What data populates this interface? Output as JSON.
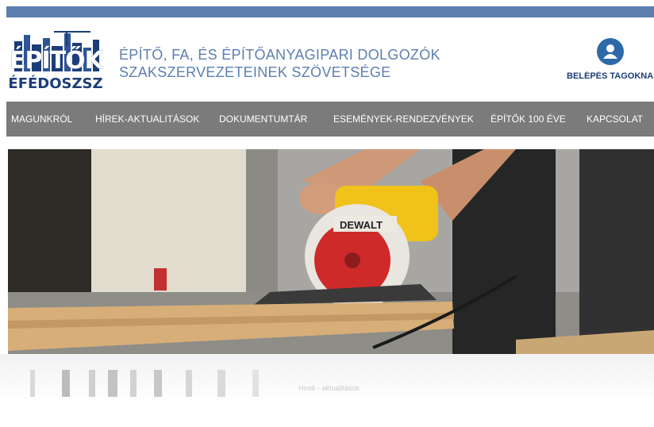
{
  "colors": {
    "accent_bar": "#5c7fb0",
    "brand_dark": "#1c3d78",
    "nav_bg": "#7b7b7b",
    "login_icon": "#2f6aa8"
  },
  "logo": {
    "top_text": "ÉPÍTŐK",
    "bottom_text": "ÉFÉDOSZSZ"
  },
  "header": {
    "org_line1": "ÉPÍTŐ, FA, ÉS ÉPÍTŐANYAGIPARI DOLGOZÓK",
    "org_line2": "SZAKSZERVEZETEINEK SZÖVETSÉGE",
    "login_icon": "user-icon",
    "login_label": "BELÉPÉS TAGOKNAK"
  },
  "nav": {
    "items": [
      {
        "label": "MAGUNKRÓL"
      },
      {
        "label": "HÍREK-AKTUALITÁSOK"
      },
      {
        "label": "DOKUMENTUMTÁR"
      },
      {
        "label": "ESEMÉNYEK-RENDEZVÉNYEK"
      },
      {
        "label": "ÉPÍTŐK 100 ÉVE"
      },
      {
        "label": "KAPCSOLAT"
      }
    ]
  },
  "hero": {
    "saw_brand": "DEWALT"
  },
  "below": {
    "section_link": "Hírek - aktualitások"
  }
}
